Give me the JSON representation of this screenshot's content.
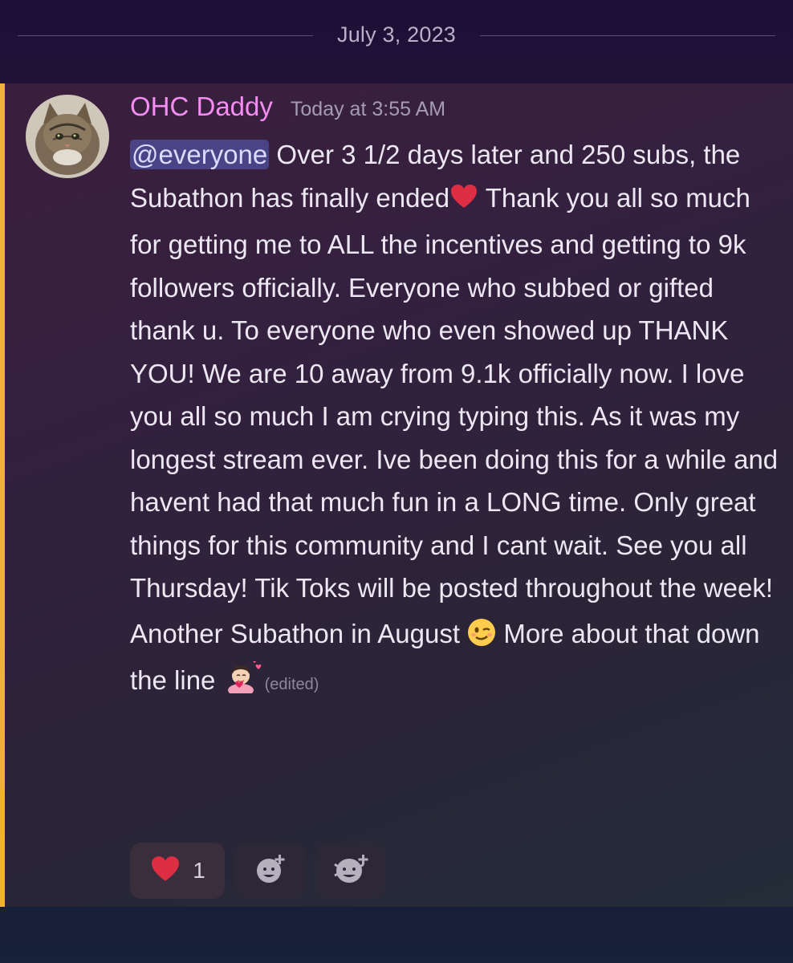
{
  "date_divider": "July 3, 2023",
  "message": {
    "author": "OHC Daddy",
    "timestamp": "Today at 3:55 AM",
    "mention": "@everyone",
    "para1_after_mention": " Over 3 1/2 days later and 250 subs, the Subathon has finally ended",
    "para1_emoji_1": "red-heart",
    "para1_rest": " Thank you all so much for getting me to ALL the incentives and getting to 9k followers officially. Everyone who subbed or gifted thank u. To everyone who even showed up THANK YOU! We are 10 away from 9.1k officially now. I love you all so much I am crying typing this. As it was my longest stream ever. Ive been doing this for a while and havent had that much fun in a LONG time. Only great things for this community and I cant wait. See you all Thursday! Tik Toks will be posted throughout the week!",
    "para2_start": "Another Subathon in August ",
    "para2_emoji_1": "winking-face",
    "para2_middle": " More about that down the line ",
    "para2_emoji_2": "person-with-hearts",
    "edited_label": "(edited)"
  },
  "reactions": [
    {
      "emoji": "red-heart",
      "count": "1"
    },
    {
      "icon": "add-reaction-icon"
    },
    {
      "icon": "add-super-reaction-icon"
    }
  ],
  "colors": {
    "username": "#f58cf2",
    "mention_bg": "#4a4386",
    "accent_bar": "#f0b232"
  }
}
